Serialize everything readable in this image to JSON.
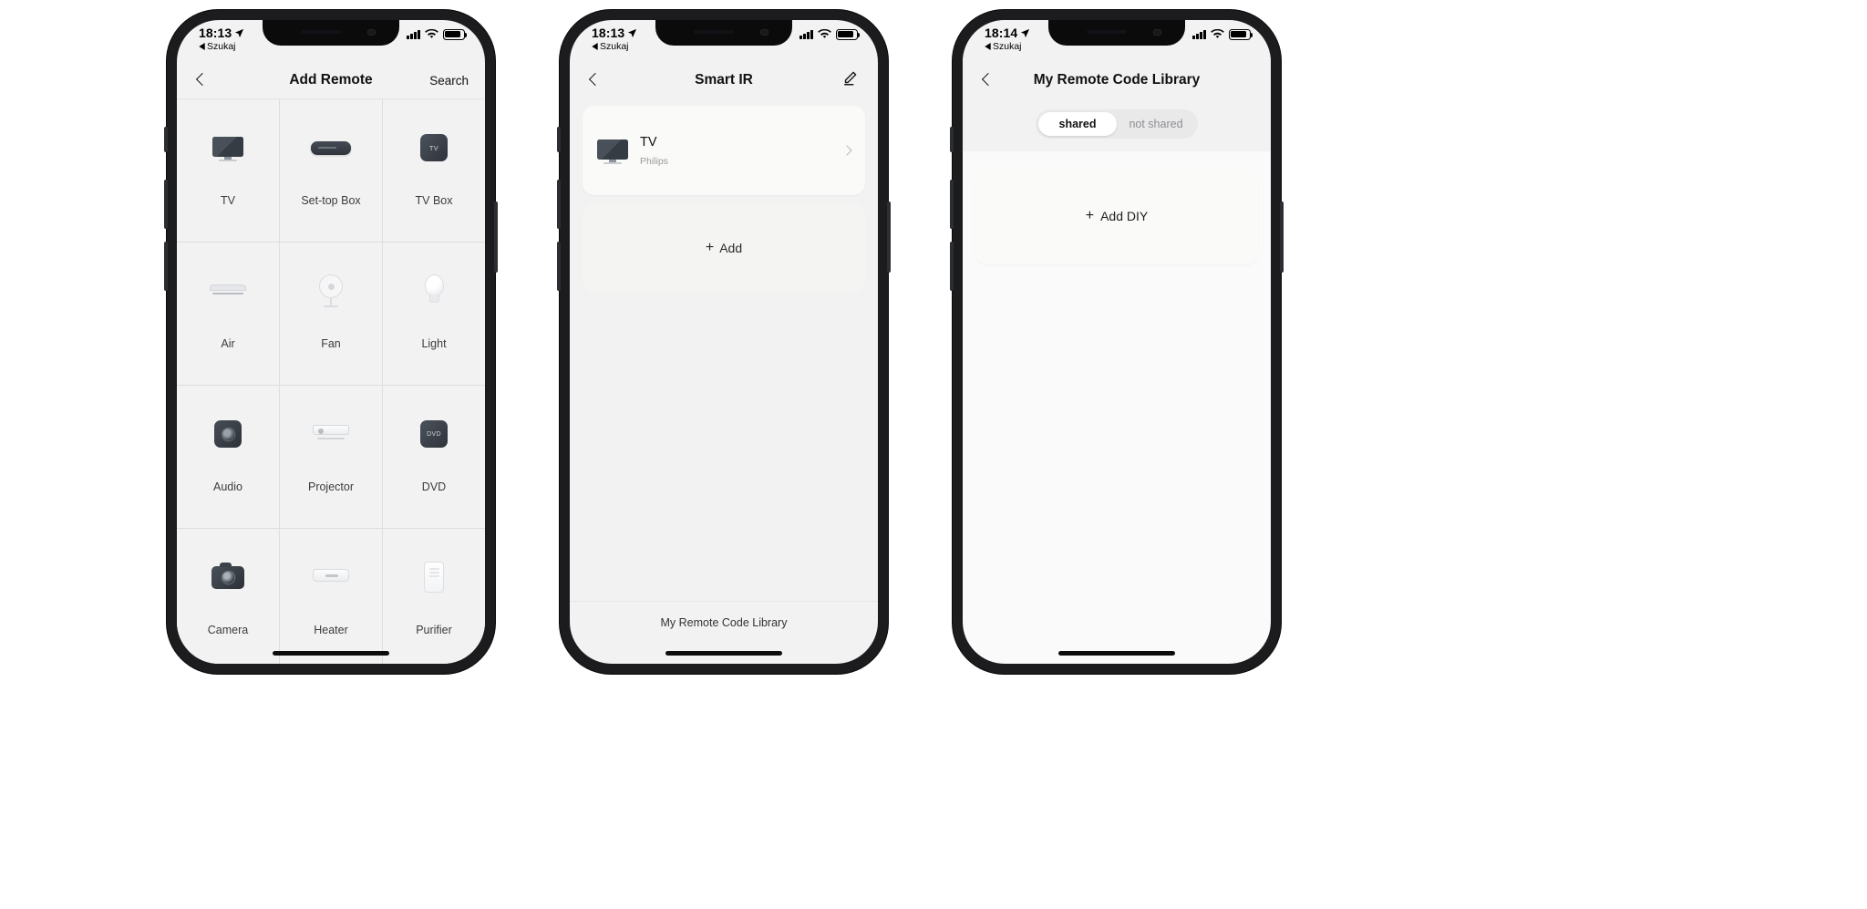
{
  "phones": [
    {
      "status": {
        "time": "18:13",
        "back_label": "Szukaj",
        "location_icon": "location-arrow-icon"
      },
      "nav": {
        "back_icon": "chevron-left-icon",
        "title": "Add Remote",
        "action_label": "Search"
      },
      "grid": [
        {
          "label": "TV",
          "icon": "tv-icon"
        },
        {
          "label": "Set-top Box",
          "icon": "set-top-box-icon"
        },
        {
          "label": "TV Box",
          "icon": "tv-box-icon",
          "badge": "TV"
        },
        {
          "label": "Air",
          "icon": "air-conditioner-icon"
        },
        {
          "label": "Fan",
          "icon": "fan-icon"
        },
        {
          "label": "Light",
          "icon": "light-bulb-icon"
        },
        {
          "label": "Audio",
          "icon": "audio-speaker-icon"
        },
        {
          "label": "Projector",
          "icon": "projector-icon"
        },
        {
          "label": "DVD",
          "icon": "dvd-player-icon",
          "badge": "DVD"
        },
        {
          "label": "Camera",
          "icon": "camera-icon"
        },
        {
          "label": "Heater",
          "icon": "heater-icon"
        },
        {
          "label": "Purifier",
          "icon": "air-purifier-icon"
        }
      ]
    },
    {
      "status": {
        "time": "18:13",
        "back_label": "Szukaj",
        "location_icon": "location-arrow-icon"
      },
      "nav": {
        "back_icon": "chevron-left-icon",
        "title": "Smart IR",
        "action_icon": "edit-pencil-icon"
      },
      "devices": [
        {
          "name": "TV",
          "brand": "Philips",
          "icon": "tv-icon",
          "chevron": "chevron-right-icon"
        }
      ],
      "add_label": "Add",
      "add_icon": "plus-icon",
      "footer_label": "My Remote Code Library"
    },
    {
      "status": {
        "time": "18:14",
        "back_label": "Szukaj",
        "location_icon": "location-arrow-icon"
      },
      "nav": {
        "back_icon": "chevron-left-icon",
        "title": "My Remote Code Library"
      },
      "segments": [
        {
          "label": "shared",
          "selected": true
        },
        {
          "label": "not shared",
          "selected": false
        }
      ],
      "add_diy_label": "Add DIY",
      "add_diy_icon": "plus-icon"
    }
  ],
  "colors": {
    "screen_bg": "#f2f2f2",
    "card_bg": "#fafaf8",
    "text_primary": "#111111",
    "text_secondary": "#9a9a9a",
    "segment_track": "#e9e9ea",
    "device_icon_dark": "#3a4048"
  }
}
